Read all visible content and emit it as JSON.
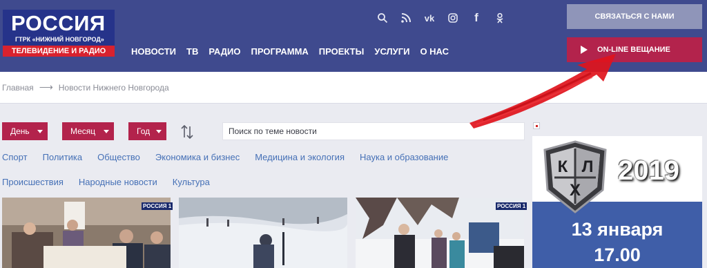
{
  "logo": {
    "title": "РОССИЯ",
    "subtitle": "ГТРК «НИЖНИЙ НОВГОРОД»",
    "tagline": "ТЕЛЕВИДЕНИЕ И РАДИО"
  },
  "nav": [
    "НОВОСТИ",
    "ТВ",
    "РАДИО",
    "ПРОГРАММА",
    "ПРОЕКТЫ",
    "УСЛУГИ",
    "О НАС"
  ],
  "header_icons": [
    "search-icon",
    "rss-icon",
    "vk-icon",
    "instagram-icon",
    "facebook-icon",
    "odnoklassniki-icon"
  ],
  "buttons": {
    "contact": "СВЯЗАТЬСЯ С НАМИ",
    "live": "ON-LINE ВЕЩАНИЕ"
  },
  "breadcrumb": [
    "Главная",
    "Новости Нижнего Новгорода"
  ],
  "filters": {
    "day": "День",
    "month": "Месяц",
    "year": "Год",
    "search_placeholder": "Поиск по теме новости"
  },
  "categories": {
    "row1": [
      "Спорт",
      "Политика",
      "Общество",
      "Экономика и бизнес",
      "Медицина и экология",
      "Наука и образование"
    ],
    "row2": [
      "Происшествия",
      "Народные новости",
      "Культура"
    ]
  },
  "thumbnails": [
    {
      "badge": "РОССИЯ 1"
    },
    {
      "badge": ""
    },
    {
      "badge": "РОССИЯ 1"
    }
  ],
  "banner": {
    "year": "2019",
    "date": "13 января",
    "time": "17.00",
    "khl_letters": [
      "К",
      "Л",
      "Х"
    ]
  },
  "colors": {
    "header_bg": "#3f4a8e",
    "accent": "#b3234c",
    "link": "#4570b6",
    "contact_btn": "#8f95b9"
  }
}
